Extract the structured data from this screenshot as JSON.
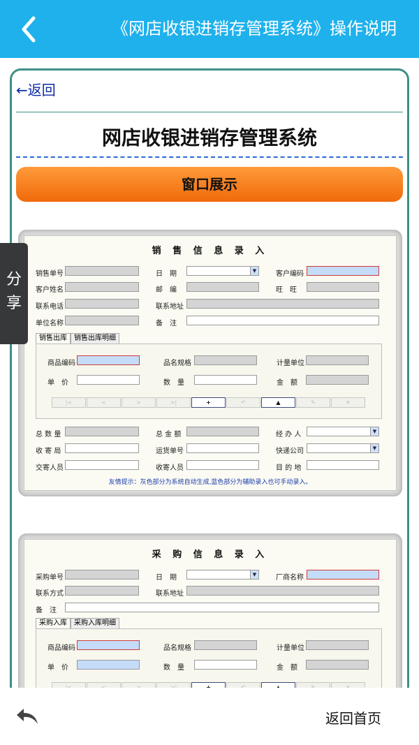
{
  "header": {
    "title": "《网店收银进销存管理系统》操作说明"
  },
  "article": {
    "back_link": "←返回",
    "system_name": "网店收银进销存管理系统",
    "section_banner": "窗口展示"
  },
  "sales_form": {
    "title": "销 售 信 息 录 入",
    "labels": [
      "销售单号",
      "日　期",
      "客户编码",
      "客户姓名",
      "邮　编",
      "旺　旺",
      "联系电话",
      "联系地址",
      "单位名称",
      "备　注"
    ],
    "tabs": [
      "销售出库",
      "销售出库明细"
    ],
    "detail_labels": [
      "商品编码",
      "品名规格",
      "计量单位",
      "单　价",
      "数　量",
      "金　额"
    ],
    "footer_labels": [
      "总 数 量",
      "总 金 额",
      "经 办 人",
      "收 寄 局",
      "运货单号",
      "快递公司",
      "交寄人员",
      "收寄人员",
      "目 的 地"
    ],
    "hint": "友情提示：灰色部分为系统自动生成,蓝色部分为辅助录入也可手动录入。"
  },
  "purchase_form": {
    "title": "采 购 信 息 录 入",
    "labels": [
      "采购单号",
      "日　期",
      "厂商名称",
      "联系方式",
      "联系地址",
      "备　注"
    ],
    "tabs": [
      "采购入库",
      "采购入库明细"
    ],
    "detail_labels": [
      "商品编码",
      "品名规格",
      "计量单位",
      "单　价",
      "数　量",
      "金　额"
    ]
  },
  "toolbar": {
    "add": "+",
    "save": "▲"
  },
  "sidebar": {
    "share": "分享"
  },
  "footer": {
    "home": "返回首页",
    "back_icon": "undo-arrow-icon"
  },
  "colors": {
    "header_bg": "#1fb1ec",
    "banner": "#f07a14",
    "card_border": "#3f8f86"
  }
}
